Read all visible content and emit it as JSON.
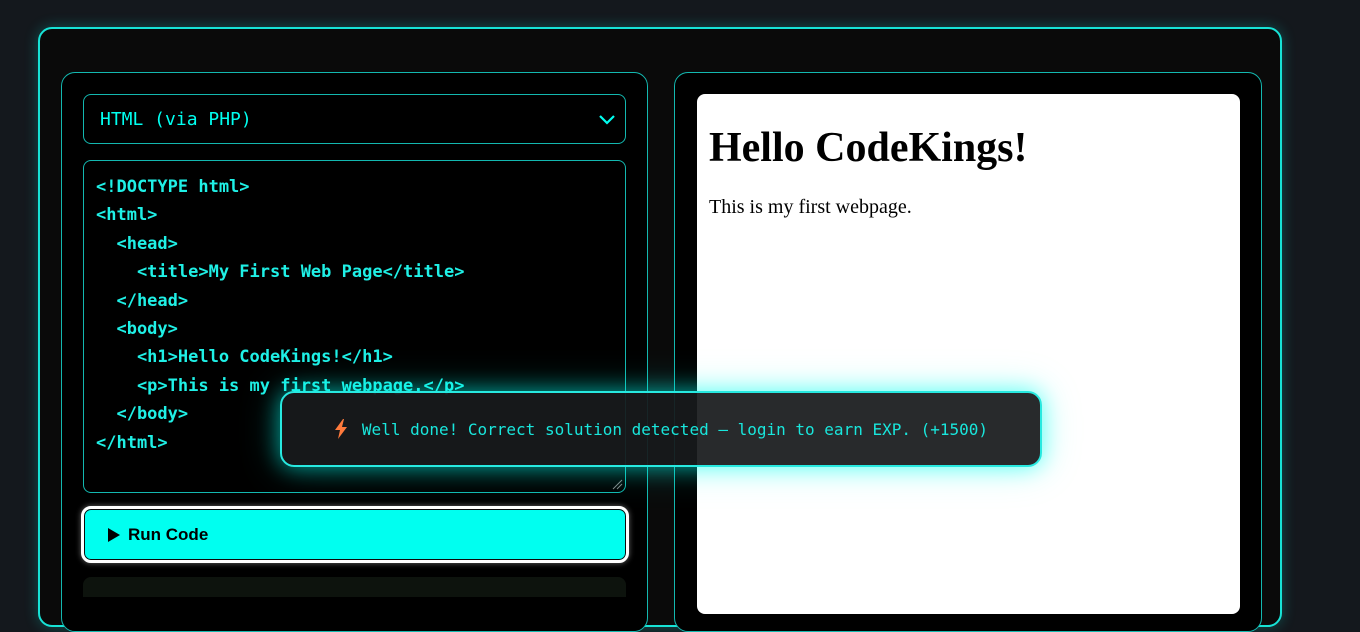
{
  "editor": {
    "language_selected": "HTML (via PHP)",
    "code_lines": [
      "<!DOCTYPE html>",
      "<html>",
      "  <head>",
      "    <title>My First Web Page</title>",
      "  </head>",
      "  <body>",
      "    <h1>Hello CodeKings!</h1>",
      "    <p>This is my first webpage.</p>",
      "  </body>",
      "</html>"
    ],
    "run_label": "Run Code"
  },
  "preview": {
    "heading": "Hello CodeKings!",
    "paragraph": "This is my first webpage."
  },
  "toast": {
    "icon": "lightning-bolt-icon",
    "message": "Well done! Correct solution detected — login to earn EXP. (+1500)"
  },
  "colors": {
    "accent": "#00fff0",
    "background": "#14181d",
    "panel": "#000000",
    "bolt": "#ff7a3c"
  }
}
